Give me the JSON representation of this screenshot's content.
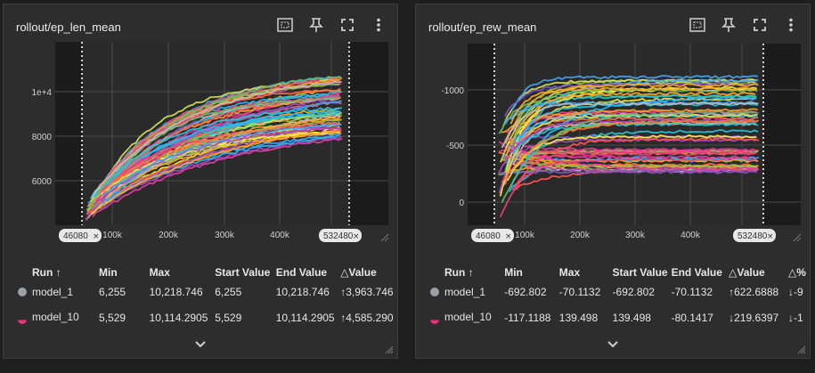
{
  "colors": {
    "run_1": "#9aa0a6",
    "run_10": "#e8337f",
    "palette": [
      "#e040a0",
      "#f5a623",
      "#26c6da",
      "#8bc34a",
      "#ffeb3b",
      "#ab47bc",
      "#ff7043",
      "#42a5f5",
      "#ec407a",
      "#ffa726",
      "#66bb6a",
      "#bdbdbd",
      "#29b6f6",
      "#d4e157",
      "#ff5252",
      "#7e57c2"
    ]
  },
  "cards": [
    {
      "title": "rollout/ep_len_mean",
      "tools": [
        "fit-domain-icon",
        "pin-icon",
        "fullscreen-icon",
        "more-icon"
      ],
      "range_start": "46080",
      "range_end": "532480",
      "headers": [
        "Run ↑",
        "Min",
        "Max",
        "Start Value",
        "End Value",
        "△Value"
      ],
      "rows": [
        {
          "run": "model_1",
          "cells": [
            "6,255",
            "10,218.746",
            "6,255",
            "10,218.746",
            "↑3,963.746"
          ]
        },
        {
          "run": "model_10",
          "cells": [
            "5,529",
            "10,114.2905",
            "5,529",
            "10,114.2905",
            "↑4,585.290"
          ]
        }
      ]
    },
    {
      "title": "rollout/ep_rew_mean",
      "tools": [
        "fit-domain-icon",
        "pin-icon",
        "fullscreen-icon",
        "more-icon"
      ],
      "range_start": "46080",
      "range_end": "532480",
      "headers": [
        "Run ↑",
        "Min",
        "Max",
        "Start Value",
        "End Value",
        "△Value",
        "△%"
      ],
      "rows": [
        {
          "run": "model_1",
          "cells": [
            "-692.802",
            "-70.1132",
            "-692.802",
            "-70.1132",
            "↑622.6888",
            "↓-9"
          ]
        },
        {
          "run": "model_10",
          "cells": [
            "-117.1188",
            "139.498",
            "139.498",
            "-80.1417",
            "↓219.6397",
            "↓-1"
          ]
        }
      ]
    }
  ],
  "chart_data": [
    {
      "type": "line",
      "title": "rollout/ep_len_mean",
      "xlabel": "",
      "ylabel": "",
      "xlim": [
        0,
        600000
      ],
      "ylim": [
        4500,
        12500
      ],
      "x_ticks": [
        "100k",
        "200k",
        "300k",
        "400k",
        "5"
      ],
      "y_ticks": [
        "6000",
        "8000",
        "1e+4"
      ],
      "grid": true,
      "series": [
        {
          "x": [
            46080,
            532480
          ],
          "values": [
            6255,
            10218.746
          ]
        },
        {
          "x": [
            46080,
            532480
          ],
          "values": [
            5529,
            10114.2905
          ]
        }
      ]
    },
    {
      "type": "line",
      "title": "rollout/ep_rew_mean",
      "xlabel": "",
      "ylabel": "",
      "xlim": [
        0,
        600000
      ],
      "ylim": [
        -1100,
        400
      ],
      "x_ticks": [
        "100k",
        "200k",
        "300k",
        "400k",
        "5"
      ],
      "y_ticks": [
        "0",
        "-500",
        "-1000"
      ],
      "grid": true,
      "series": [
        {
          "x": [
            46080,
            532480
          ],
          "values": [
            -692.802,
            -70.1132
          ]
        },
        {
          "x": [
            46080,
            532480
          ],
          "values": [
            139.498,
            -80.1417
          ]
        }
      ]
    }
  ]
}
